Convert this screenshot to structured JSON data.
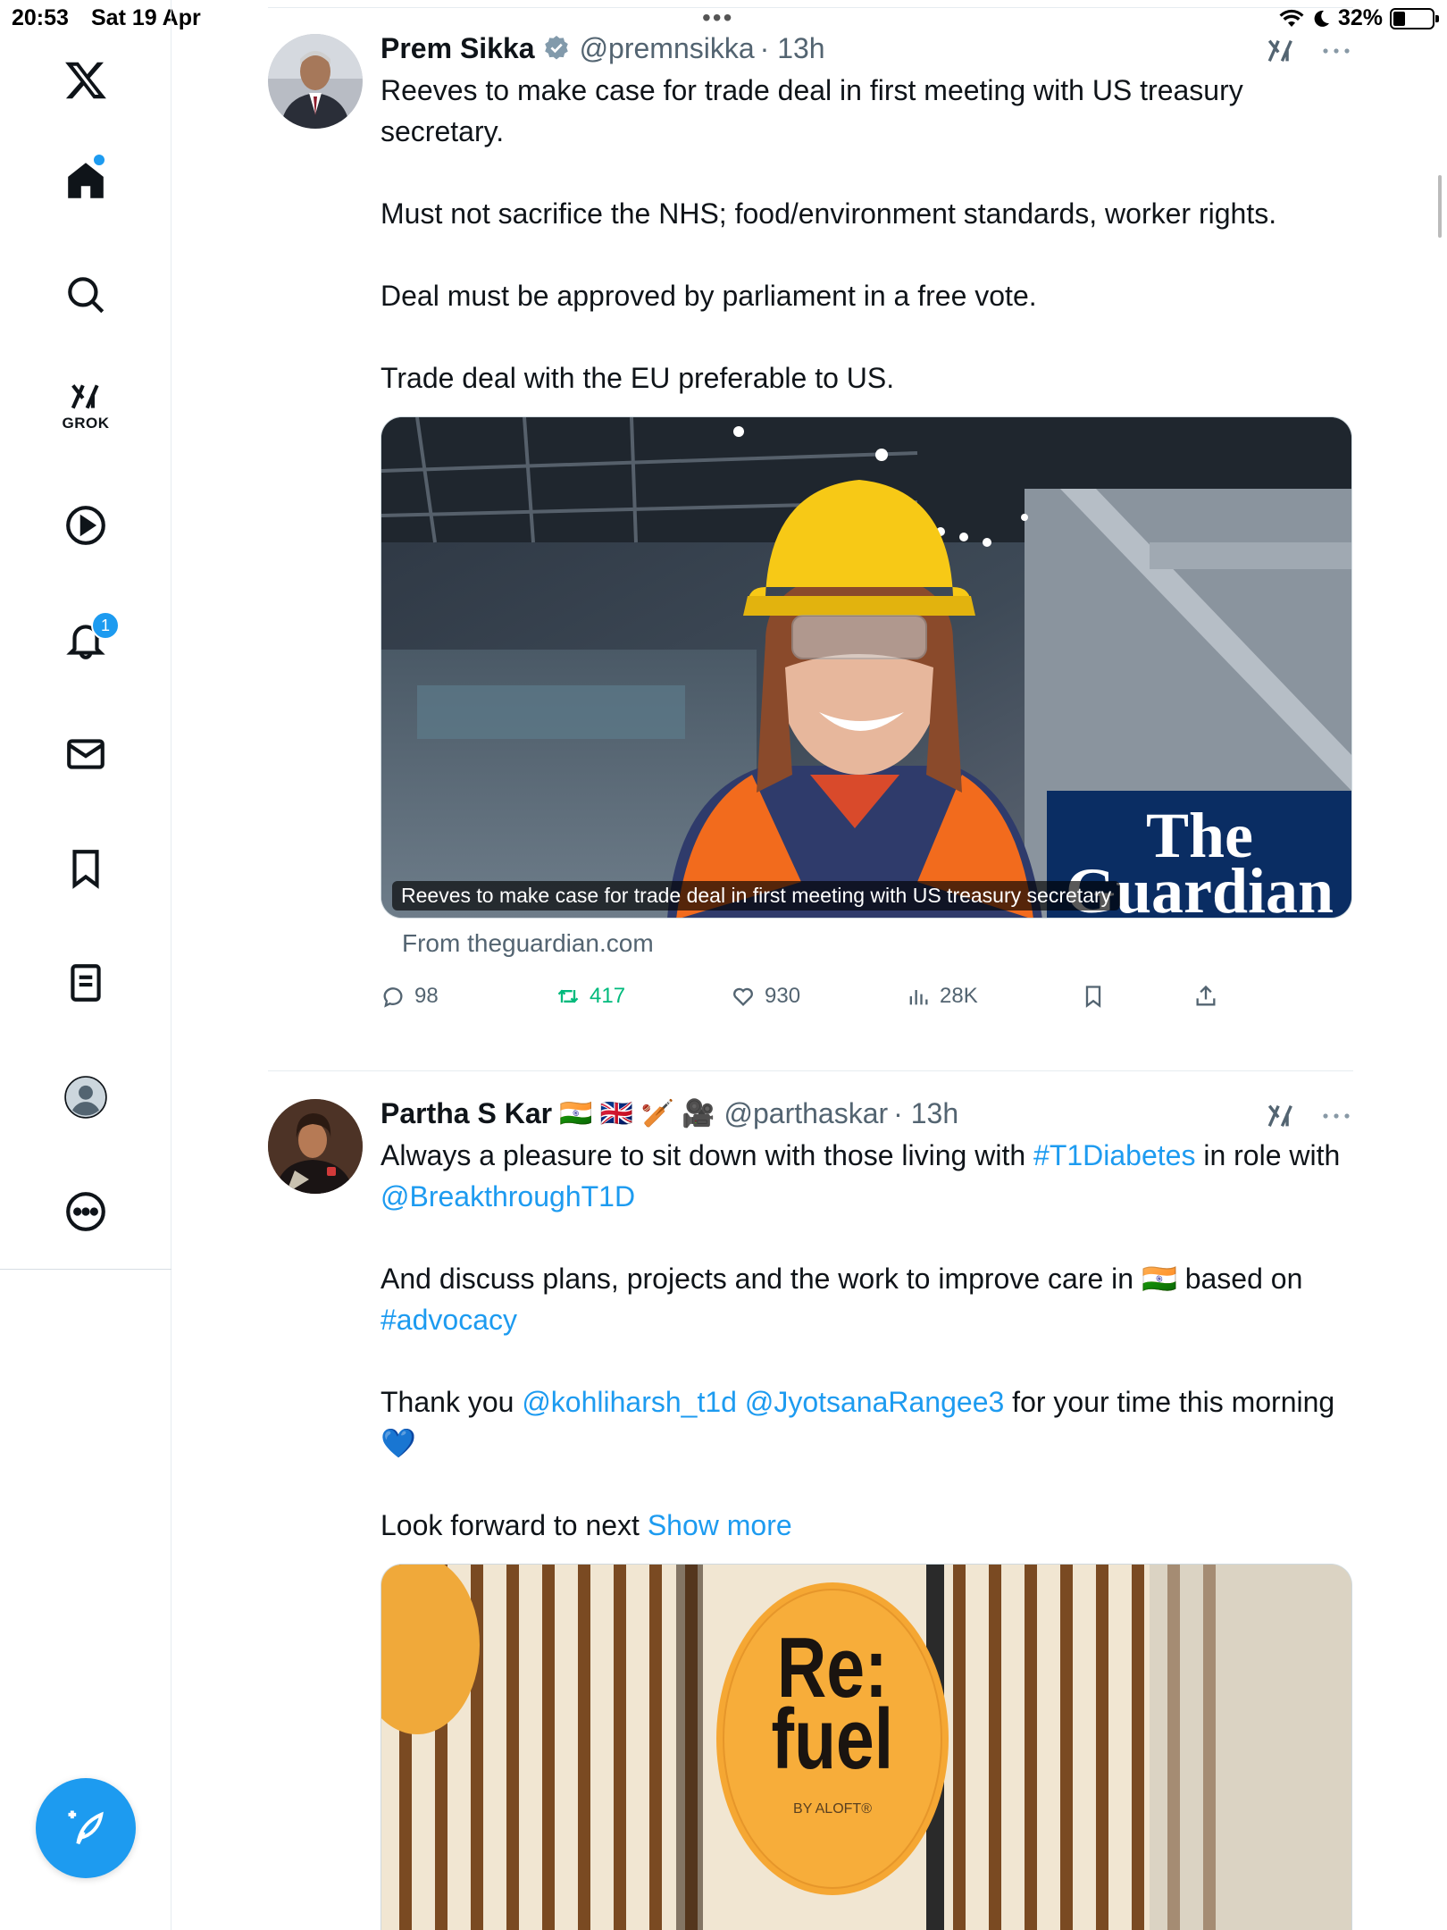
{
  "status_bar": {
    "time": "20:53",
    "date": "Sat 19 Apr",
    "battery": "32%"
  },
  "sidebar": {
    "grok_label": "GROK",
    "notifications_badge": "1"
  },
  "colors": {
    "accent": "#1d9bf0",
    "retweet": "#00ba7c",
    "secondary_text": "#536471"
  },
  "tweets": [
    {
      "name": "Prem Sikka",
      "handle": "@premnsikka",
      "time": "· 13h",
      "verified": true,
      "paragraphs": [
        "Reeves to make case for trade deal in first meeting with US treasury secretary.",
        "Must not sacrifice the NHS; food/environment standards, worker rights.",
        "Deal must be approved by parliament in a free vote.",
        "Trade deal with the EU preferable to US."
      ],
      "card_caption": "Reeves to make case for trade deal in first meeting with US treasury secretary",
      "card_logo_line1": "The",
      "card_logo_line2": "Guardian",
      "card_source": "From theguardian.com",
      "replies": "98",
      "retweets": "417",
      "likes": "930",
      "views": "28K"
    },
    {
      "name": "Partha S Kar",
      "name_emoji": "🇮🇳 🇬🇧 🏏 🎥",
      "handle": "@parthaskar",
      "time": "· 13h",
      "p1_a": "Always a pleasure to sit down with those living with ",
      "p1_tag": "#T1Diabetes",
      "p1_b": " in role with ",
      "p1_mention": "@BreakthroughT1D",
      "p2_a": "And discuss plans, projects and the work to improve care in ",
      "p2_flag": "🇮🇳",
      "p2_b": " based on ",
      "p2_tag": "#advocacy",
      "p3_a": "Thank you ",
      "p3_m1": "@kohliharsh_t1d",
      "p3_m2": "@JyotsanaRangee3",
      "p3_b": " for your time this morning ",
      "p3_emoji": "💙",
      "p4_a": "Look forward to next ",
      "show_more": "Show more",
      "image_sign_line1": "Re:",
      "image_sign_line2": "fuel",
      "image_sign_sub": "BY ALOFT®"
    }
  ]
}
